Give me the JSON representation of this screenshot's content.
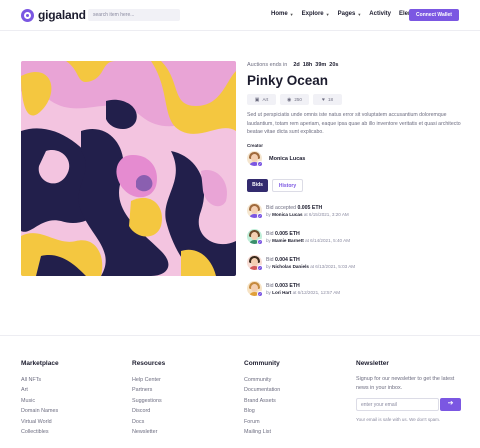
{
  "header": {
    "logo_text": "gigaland",
    "search_placeholder": "search item here...",
    "nav": [
      {
        "label": "Home",
        "has_menu": true
      },
      {
        "label": "Explore",
        "has_menu": true
      },
      {
        "label": "Pages",
        "has_menu": true
      },
      {
        "label": "Activity",
        "has_menu": false
      },
      {
        "label": "Elements",
        "has_menu": true
      }
    ],
    "connect_button": "Connect Wallet"
  },
  "item": {
    "auction_label": "Auctions ends in",
    "countdown": [
      "2d",
      "18h",
      "39m",
      "20s"
    ],
    "title": "Pinky Ocean",
    "stats": [
      {
        "icon": "image-icon",
        "glyph": "▣",
        "value": "Art"
      },
      {
        "icon": "eye-icon",
        "glyph": "◉",
        "value": "250"
      },
      {
        "icon": "heart-icon",
        "glyph": "♥",
        "value": "18"
      }
    ],
    "description": "Sed ut perspiciatis unde omnis iste natus error sit voluptatem accusantium doloremque laudantium, totam rem aperiam, eaque ipsa quae ab illo inventore veritatis et quasi architecto beatae vitae dicta sunt explicabo.",
    "creator_label": "Creator",
    "creator_name": "Monica Lucas"
  },
  "tabs": {
    "bids": "Bids",
    "history": "History"
  },
  "bids": [
    {
      "action": "Bid accepted",
      "amount": "0.005 ETH",
      "by": "by",
      "name": "Monica Lucas",
      "at": "at 6/15/2021, 3:20 AM",
      "hair": "#a06a3d",
      "bg": "#f5e6cf"
    },
    {
      "action": "Bid",
      "amount": "0.005 ETH",
      "by": "by",
      "name": "Mamie Barnett",
      "at": "at 6/14/2021, 5:40 AM",
      "hair": "#6b4a2a",
      "bg": "#bfeed8"
    },
    {
      "action": "Bid",
      "amount": "0.004 ETH",
      "by": "by",
      "name": "Nicholas Daniels",
      "at": "at 6/13/2021, 5:03 AM",
      "hair": "#3b2a1c",
      "bg": "#f7dcd4"
    },
    {
      "action": "Bid",
      "amount": "0.003 ETH",
      "by": "by",
      "name": "Lori Hart",
      "at": "at 6/12/2021, 12:57 AM",
      "hair": "#c58a3e",
      "bg": "#f7e3c4"
    }
  ],
  "footer": {
    "marketplace": {
      "title": "Marketplace",
      "links": [
        "All NFTs",
        "Art",
        "Music",
        "Domain Names",
        "Virtual World",
        "Collectibles"
      ]
    },
    "resources": {
      "title": "Resources",
      "links": [
        "Help Center",
        "Partners",
        "Suggestions",
        "Discord",
        "Docs",
        "Newsletter"
      ]
    },
    "community": {
      "title": "Community",
      "links": [
        "Community",
        "Documentation",
        "Brand Assets",
        "Blog",
        "Forum",
        "Mailing List"
      ]
    },
    "newsletter": {
      "title": "Newsletter",
      "text": "Signup for our newsletter to get the latest news in your inbox.",
      "placeholder": "enter your email",
      "note": "Your email is safe with us. We don't spam."
    }
  },
  "colors": {
    "accent": "#7b57e2",
    "dark_tab": "#332b6e"
  }
}
